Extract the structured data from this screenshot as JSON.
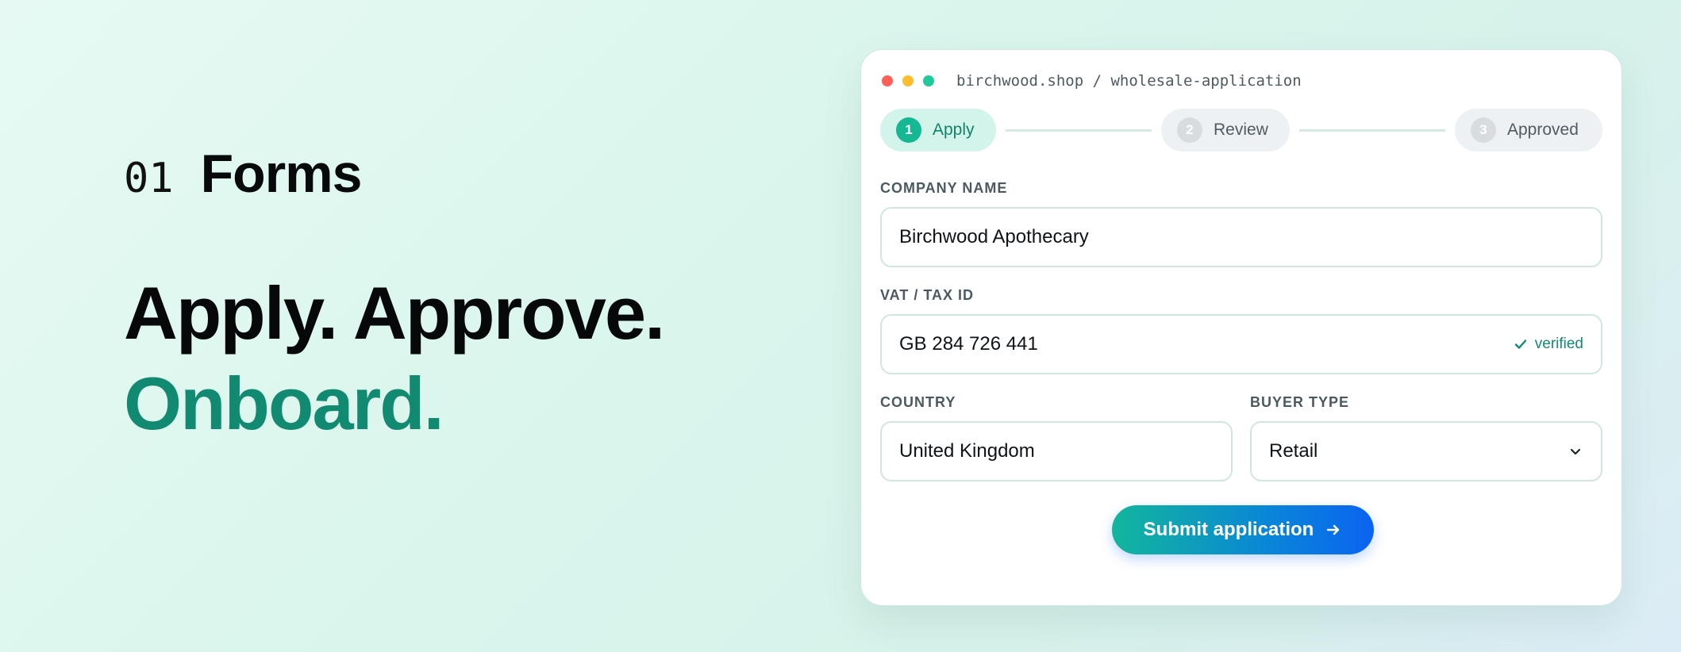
{
  "section": {
    "number": "01",
    "title": "Forms"
  },
  "headline": {
    "line1": "Apply. Approve.",
    "line2": "Onboard."
  },
  "window": {
    "url": "birchwood.shop / wholesale-application"
  },
  "steps": [
    {
      "num": "1",
      "label": "Apply",
      "state": "active"
    },
    {
      "num": "2",
      "label": "Review",
      "state": "inactive"
    },
    {
      "num": "3",
      "label": "Approved",
      "state": "inactive"
    }
  ],
  "form": {
    "company": {
      "label": "COMPANY NAME",
      "value": "Birchwood Apothecary"
    },
    "vat": {
      "label": "VAT / TAX ID",
      "value": "GB 284 726 441",
      "status": "verified"
    },
    "country": {
      "label": "COUNTRY",
      "value": "United Kingdom"
    },
    "buyer_type": {
      "label": "BUYER TYPE",
      "value": "Retail"
    },
    "submit_label": "Submit application"
  },
  "icons": {
    "verified": "check-icon",
    "dropdown": "chevron-down-icon",
    "submit": "arrow-right-icon"
  },
  "colors": {
    "accent": "#128a72",
    "step_active": "#16b793",
    "button_start": "#12b69c",
    "button_end": "#0b63f0"
  }
}
